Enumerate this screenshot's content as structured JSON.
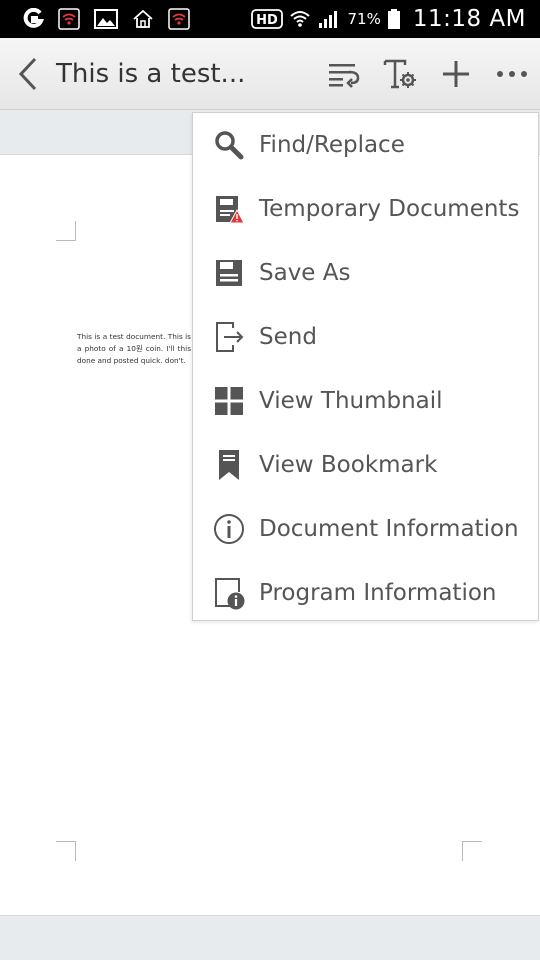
{
  "status_bar": {
    "hd_label": "HD",
    "battery_pct": "71%",
    "clock": "11:18 AM"
  },
  "toolbar": {
    "title": "This is a test..."
  },
  "document": {
    "text": "This is a test document. This is a photo of a 10원 coin. I'll this done and posted quick. don't."
  },
  "menu": {
    "items": [
      {
        "label": "Find/Replace",
        "icon": "search-icon"
      },
      {
        "label": "Temporary Documents",
        "icon": "temp-document-icon"
      },
      {
        "label": "Save As",
        "icon": "save-icon"
      },
      {
        "label": "Send",
        "icon": "send-icon"
      },
      {
        "label": "View Thumbnail",
        "icon": "thumbnail-icon"
      },
      {
        "label": "View Bookmark",
        "icon": "bookmark-icon"
      },
      {
        "label": "Document Information",
        "icon": "info-icon"
      },
      {
        "label": "Program Information",
        "icon": "program-info-icon"
      }
    ]
  },
  "colors": {
    "icon": "#555555",
    "warning": "#e53935",
    "status_bar": "#000000",
    "toolbar": "#f0f0f0"
  }
}
